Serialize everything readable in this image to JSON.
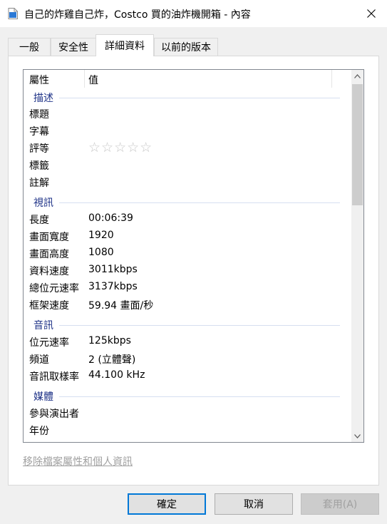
{
  "window": {
    "title": "自己的炸雞自己炸，Costco 買的油炸機開箱 - 內容",
    "file_icon": "video-file-icon",
    "close_icon": "close-icon"
  },
  "tabs": [
    {
      "label": "一般"
    },
    {
      "label": "安全性"
    },
    {
      "label": "詳細資料"
    },
    {
      "label": "以前的版本"
    }
  ],
  "active_tab": "詳細資料",
  "list": {
    "header": {
      "property": "屬性",
      "value": "值"
    },
    "groups": {
      "description": "描述",
      "video": "視訊",
      "audio": "音訊",
      "media": "媒體"
    },
    "rows": {
      "title": {
        "k": "標題",
        "v": ""
      },
      "subtitle": {
        "k": "字幕",
        "v": ""
      },
      "rating": {
        "k": "評等",
        "v": "☆☆☆☆☆"
      },
      "tags": {
        "k": "標籤",
        "v": ""
      },
      "comments": {
        "k": "註解",
        "v": ""
      },
      "length": {
        "k": "長度",
        "v": "00:06:39"
      },
      "frame_width": {
        "k": "畫面寬度",
        "v": "1920"
      },
      "frame_height": {
        "k": "畫面高度",
        "v": "1080"
      },
      "data_rate": {
        "k": "資料速度",
        "v": "3011kbps"
      },
      "total_bitrate": {
        "k": "總位元速率",
        "v": "3137kbps"
      },
      "frame_rate": {
        "k": "框架速度",
        "v": "59.94 畫面/秒"
      },
      "audio_bitrate": {
        "k": "位元速率",
        "v": "125kbps"
      },
      "channels": {
        "k": "頻道",
        "v": "2 (立體聲)"
      },
      "sample_rate": {
        "k": "音訊取樣率",
        "v": "44.100 kHz"
      },
      "contributing_artists": {
        "k": "參與演出者",
        "v": ""
      },
      "year": {
        "k": "年份",
        "v": ""
      }
    },
    "rating_stars": 0
  },
  "remove_link": "移除檔案屬性和個人資訊",
  "buttons": {
    "ok": "確定",
    "cancel": "取消",
    "apply": "套用(A)"
  }
}
